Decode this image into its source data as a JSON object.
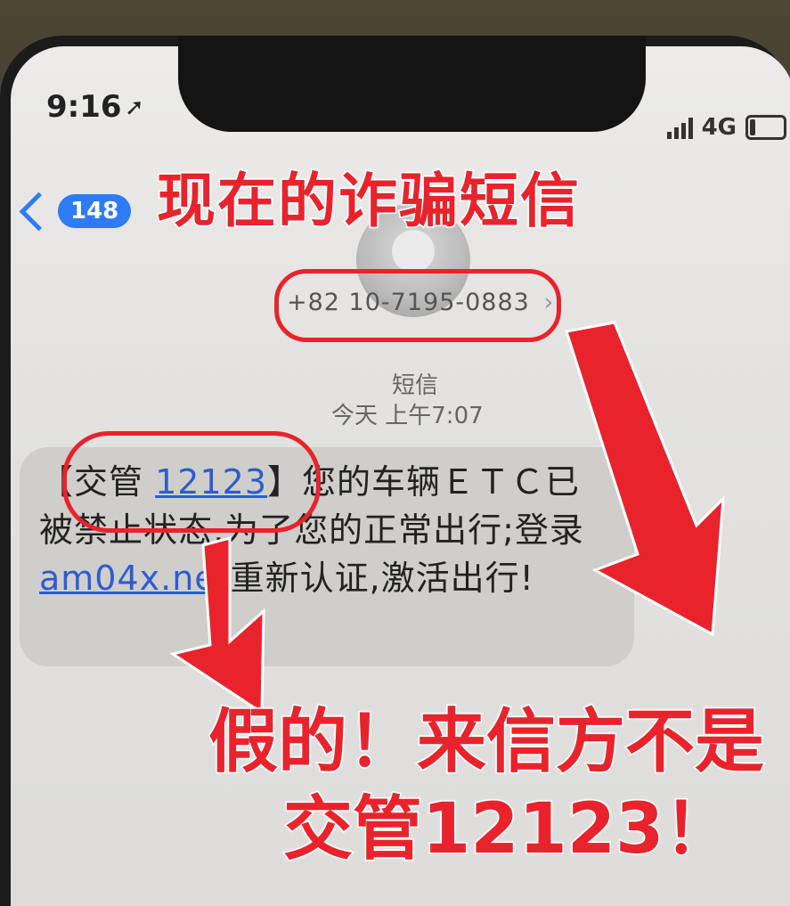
{
  "status_bar": {
    "time": "9:16",
    "location_icon": "location-arrow-icon",
    "network": "4G"
  },
  "nav": {
    "back_count": "148"
  },
  "conversation": {
    "contact": "+82 10-7195-0883",
    "contact_chevron": "›",
    "message_type": "短信",
    "timestamp": "今天 上午7:07"
  },
  "message": {
    "bracket_open": "【",
    "sender_name": "交管",
    "sender_number": "12123",
    "bracket_close": "】",
    "text_part1": "您的车辆ＥＴＣ已被禁止状态,为了您的正常出行;登录 ",
    "link": "am04x.net",
    "text_part2": "重新认证,激活出行!"
  },
  "annotations": {
    "headline": "现在的诈骗短信",
    "warning_line1": "假的！来信方不是",
    "warning_line2": "交管12123！",
    "highlight_color": "#e8232c"
  },
  "colors": {
    "ios_blue": "#2d7cf6",
    "link_blue": "#2c5dd1",
    "bubble": "#cfcecb"
  }
}
